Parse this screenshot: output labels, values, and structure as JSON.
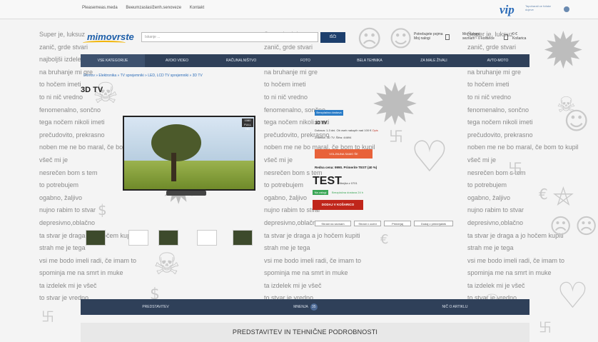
{
  "background_text": [
    "Super je, luksuz",
    "zanič, grde stvari",
    "najboljši izdelek",
    "na bruhanje mi gre",
    "to hočem imeti",
    "to ni nič vredno",
    "fenomenalno, sončno",
    "tega nočem nikoli imeti",
    "prečudovito, prekrasno",
    "noben me ne bo maral, če bom to kupil",
    "všeč mi je",
    "nesrečen bom s tem",
    "to potrebujem",
    "ogabno, žaljivo",
    "nujno rabim to stvar",
    "depresivno,oblačno",
    "ta stvar je draga a jo hočem kupiti",
    "strah me je tega",
    "vsi me bodo imeli radi, če imam to",
    "spominja me na smrt in muke",
    "ta izdelek mi je všeč",
    "to stvar je vredno"
  ],
  "top_nav": {
    "links": [
      "Pleasemeas.meda",
      "Beeumzaslaslženh.senoveze",
      "Kontakt"
    ],
    "vip_logo": "vip",
    "vip_sub": "Tapoharati ce fofake dojeve"
  },
  "header": {
    "logo": "mimovrste",
    "search_placeholder": "Iskanje ...",
    "search_button": "IŠČI",
    "items": [
      {
        "line1": "Potrebujete pojma",
        "line2": "Moj nalogi"
      },
      {
        "line1": "Moj nakupi",
        "line2": "seznam - 0 košarice"
      },
      {
        "line1": "0 €",
        "line2": "Košarica"
      }
    ]
  },
  "categories": [
    "VSE KATEGORIJE",
    "AVDIO VIDEO",
    "RAČUNALNIŠTVO",
    "FOTO",
    "BELA TEHNIKA",
    "ZA MALE ŽIVALI",
    "AVTO-MOTO"
  ],
  "breadcrumb": "Domov » Elektronika » TV sprejemniki » LED, LCD TV sprejemniki » 3D TV",
  "product": {
    "title": "3D TV",
    "tv_badge": "1080 FULL HD",
    "badge_blue": "Brezplačna dostava",
    "info_title": "3D TV",
    "info_lines": [
      "Dobava: 1-3 dni. Ob vseh nakupih nad 100 €",
      "Znamka: 3D TV. Šifra: 44694"
    ],
    "info_link": "Opis",
    "orange_button": "VOLJNUNA SAMO ŠE",
    "price_line": "Redna cena: 9990. Primerite TEST (40 %)",
    "test_label": "TEST",
    "test_note": "Hitrejša z 0701",
    "green_badge": "Na zalogi",
    "green_link": "Brezplačna dostava 24 h",
    "cart_button": "DODAJ V KOŠARICO",
    "small_buttons": [
      "Shrani na seznam",
      "Shrani v oceni",
      "Primerjaj",
      "Dodaj v primerjalnik"
    ]
  },
  "bottom_tabs": {
    "tabs": [
      "PREDSTAVITEV",
      "MNENJA",
      "NIČ O ARTIKLU"
    ],
    "count": "35"
  },
  "section_title": "PREDSTAVITEV IN TEHNIČNE PODROBNOSTI",
  "colors": {
    "nav_dark": "#2f4059",
    "brand_blue": "#1d5ea8",
    "orange": "#e8623a",
    "red": "#c0261b",
    "green": "#3aa655"
  }
}
